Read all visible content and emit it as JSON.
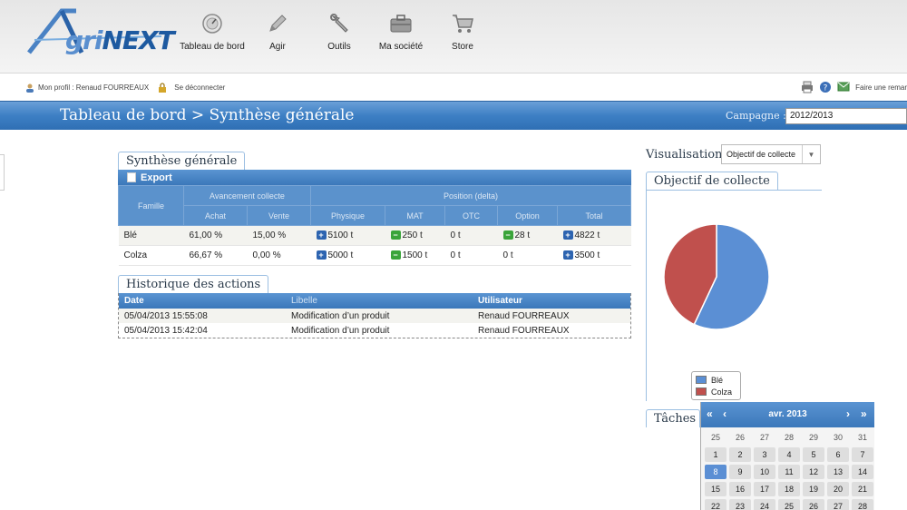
{
  "brand": {
    "logo_a": "A",
    "logo_gri": "gri",
    "logo_next": "NEXT"
  },
  "nav": [
    {
      "label": "Tableau de bord",
      "icon": "dashboard-gauge-icon"
    },
    {
      "label": "Agir",
      "icon": "pencil-icon"
    },
    {
      "label": "Outils",
      "icon": "wrench-icon"
    },
    {
      "label": "Ma société",
      "icon": "briefcase-icon"
    },
    {
      "label": "Store",
      "icon": "cart-icon"
    }
  ],
  "user": {
    "profile": "Mon profil : Renaud FOURREAUX",
    "logout": "Se déconnecter"
  },
  "tools": {
    "remark": "Faire une remar"
  },
  "header": {
    "title": "Tableau de bord > Synthèse générale",
    "campaign_label": "Campagne :",
    "campaign_value": "2012/2013"
  },
  "synthese": {
    "title": "Synthèse générale",
    "export": "Export",
    "group_headers": {
      "famille": "Famille",
      "avancement": "Avancement collecte",
      "position": "Position (delta)"
    },
    "columns": [
      "Achat",
      "Vente",
      "Physique",
      "MAT",
      "OTC",
      "Option",
      "Total"
    ],
    "rows": [
      {
        "famille": "Blé",
        "achat": "61,00 %",
        "vente": "15,00 %",
        "physique": "5100 t",
        "mat": "250 t",
        "otc": "0 t",
        "option": "28 t",
        "total": "4822 t"
      },
      {
        "famille": "Colza",
        "achat": "66,67 %",
        "vente": "0,00 %",
        "physique": "5000 t",
        "mat": "1500 t",
        "otc": "0 t",
        "option": "0 t",
        "total": "3500 t"
      }
    ]
  },
  "historique": {
    "title": "Historique des actions",
    "columns": {
      "date": "Date",
      "libelle": "Libelle",
      "utilisateur": "Utilisateur"
    },
    "rows": [
      {
        "date": "05/04/2013 15:55:08",
        "libelle": "Modification d’un produit",
        "utilisateur": "Renaud FOURREAUX"
      },
      {
        "date": "05/04/2013 15:42:04",
        "libelle": "Modification d’un produit",
        "utilisateur": "Renaud FOURREAUX"
      }
    ]
  },
  "visualisation": {
    "label": "Visualisation",
    "selected": "Objectif de collecte"
  },
  "objectif": {
    "title": "Objectif de collecte",
    "legend": [
      {
        "name": "Blé",
        "color": "#5b8fd4"
      },
      {
        "name": "Colza",
        "color": "#c0504d"
      }
    ]
  },
  "chart_data": {
    "type": "pie",
    "categories": [
      "Blé",
      "Colza"
    ],
    "values": [
      57,
      43
    ],
    "colors": [
      "#5b8fd4",
      "#c0504d"
    ],
    "legend": "bottom"
  },
  "taches": {
    "title": "Tâches"
  },
  "calendar": {
    "month": "avr. 2013",
    "nav": {
      "first": "«",
      "prev": "‹",
      "next": "›",
      "last": "»"
    },
    "days": [
      [
        "25",
        "26",
        "27",
        "28",
        "29",
        "30",
        "31"
      ],
      [
        "1",
        "2",
        "3",
        "4",
        "5",
        "6",
        "7"
      ],
      [
        "8",
        "9",
        "10",
        "11",
        "12",
        "13",
        "14"
      ],
      [
        "15",
        "16",
        "17",
        "18",
        "19",
        "20",
        "21"
      ],
      [
        "22",
        "23",
        "24",
        "25",
        "26",
        "27",
        "28"
      ]
    ],
    "selected": "8"
  }
}
